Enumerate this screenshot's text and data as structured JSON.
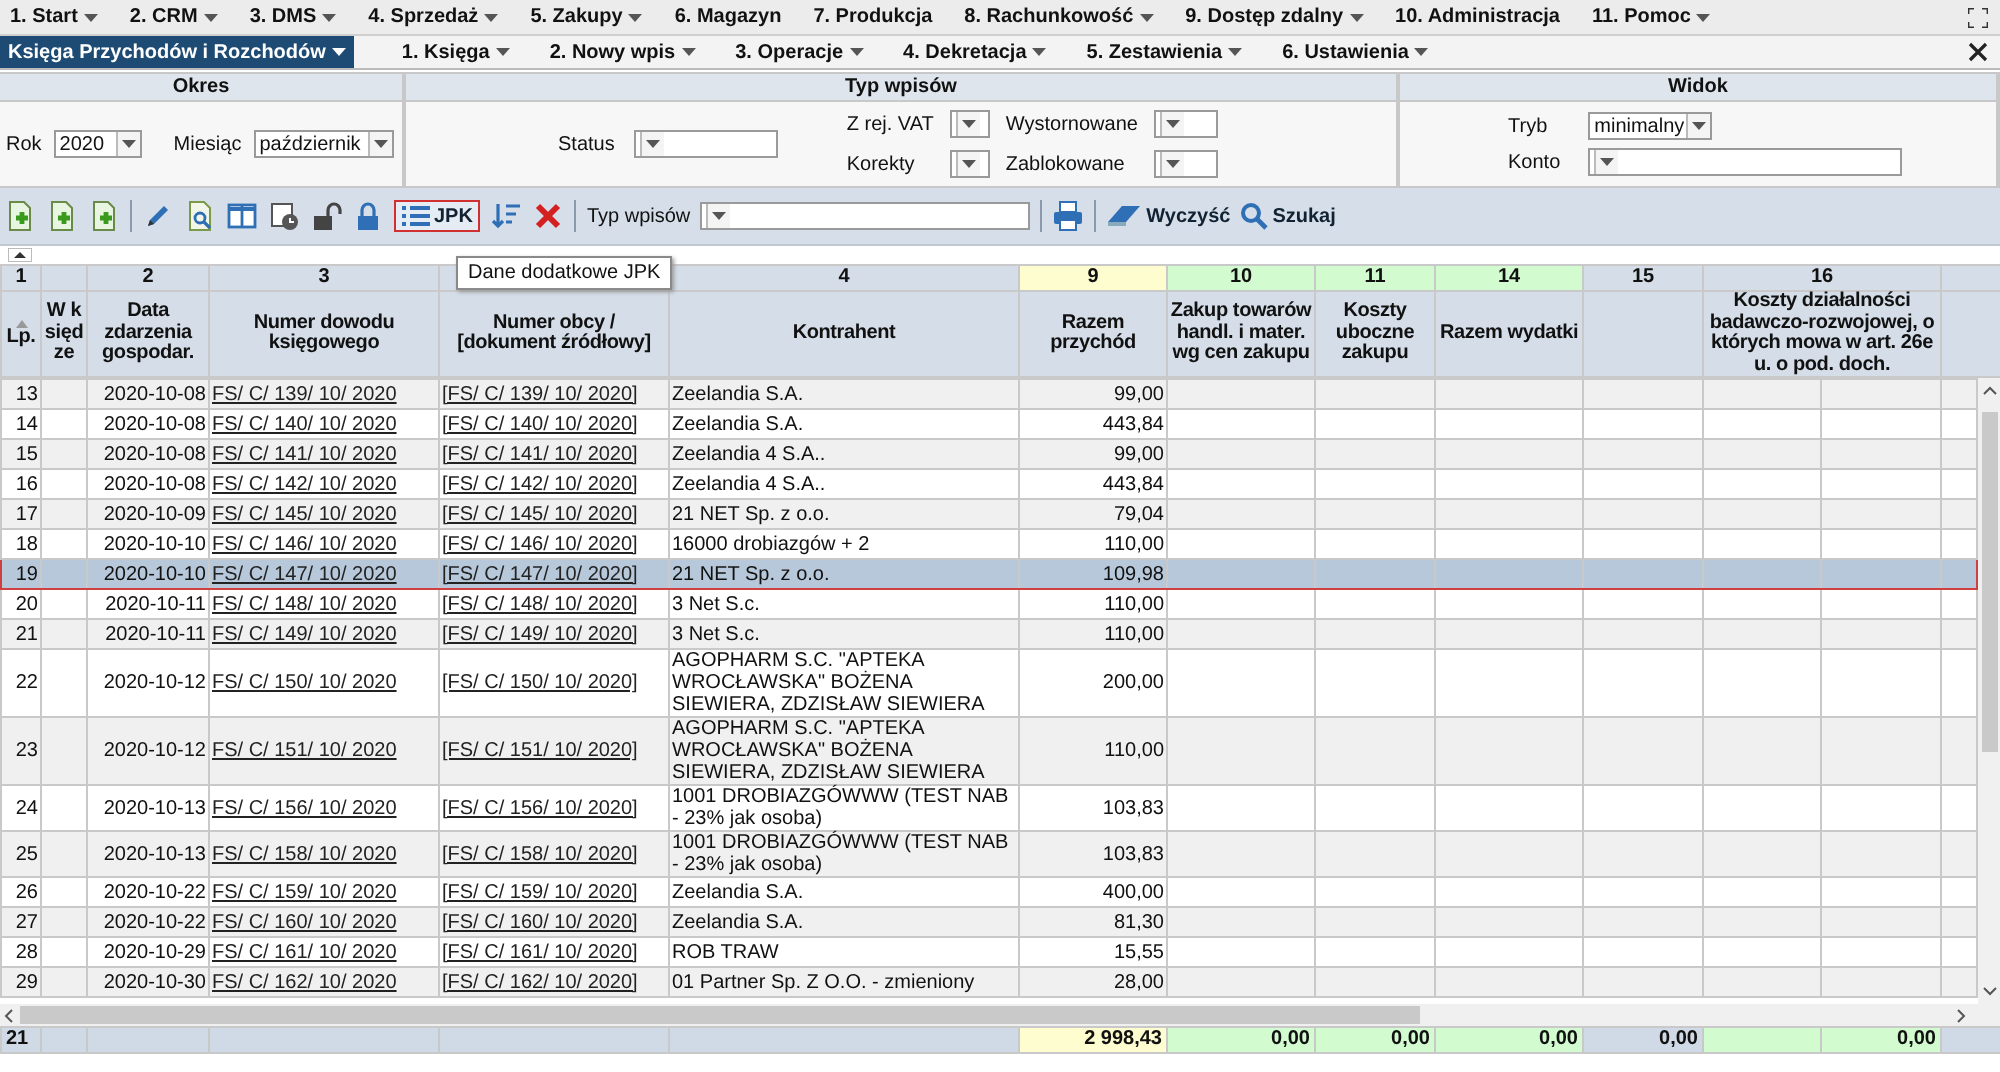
{
  "menu": [
    {
      "label": "1. Start",
      "dropdown": true
    },
    {
      "label": "2. CRM",
      "dropdown": true
    },
    {
      "label": "3. DMS",
      "dropdown": true
    },
    {
      "label": "4. Sprzedaż",
      "dropdown": true
    },
    {
      "label": "5. Zakupy",
      "dropdown": true
    },
    {
      "label": "6. Magazyn",
      "dropdown": false
    },
    {
      "label": "7. Produkcja",
      "dropdown": false
    },
    {
      "label": "8. Rachunkowość",
      "dropdown": true
    },
    {
      "label": "9. Dostęp zdalny",
      "dropdown": true
    },
    {
      "label": "10. Administracja",
      "dropdown": false
    },
    {
      "label": "11. Pomoc",
      "dropdown": true
    }
  ],
  "module_bar": {
    "tabs": [
      {
        "label": "Księga Przychodów i Rozchodów",
        "selected": true
      }
    ],
    "items": [
      {
        "label": "1. Księga"
      },
      {
        "label": "2. Nowy wpis"
      },
      {
        "label": "3. Operacje"
      },
      {
        "label": "4. Dekretacja"
      },
      {
        "label": "5. Zestawienia"
      },
      {
        "label": "6. Ustawienia"
      }
    ]
  },
  "filters": [
    {
      "title": "Okres",
      "fields": [
        {
          "label": "Rok",
          "value": "2020"
        },
        {
          "label": "Miesiąc",
          "value": "październik"
        }
      ]
    },
    {
      "title": "Typ wpisów",
      "fields": [
        {
          "label": "Status"
        },
        {
          "label": "Z rej. VAT"
        },
        {
          "label": "Korekty"
        },
        {
          "label": "Wystornowane"
        },
        {
          "label": "Zablokowane"
        }
      ]
    },
    {
      "title": "Widok",
      "fields": [
        {
          "label": "Tryb",
          "value": "minimalny"
        },
        {
          "label": "Konto"
        }
      ]
    }
  ],
  "toolbar": {
    "jpk_button": {
      "label": "JPK",
      "highlighted": true
    },
    "type_filter": {
      "label": "Typ wpisów"
    },
    "clear_button": "Wyczyść",
    "search_button": "Szukaj",
    "tooltip": "Dane dodatkowe JPK"
  },
  "table": {
    "columns": [
      {
        "number": "1",
        "header": "Lp.",
        "sorted": true
      },
      {
        "header": "W księdze",
        "sorted": false
      },
      {
        "number": "2",
        "header": "Data zdarzenia gospodar.",
        "sorted": false
      },
      {
        "number": "3",
        "header": "Numer dowodu księgowego",
        "sorted": false
      },
      {
        "header": "Numer obcy / [dokument źródłowy]",
        "sorted": false
      },
      {
        "number": "4",
        "header": "Kontrahent",
        "sorted": false
      },
      {
        "number": "9",
        "header": "Razem przychód",
        "sorted": false,
        "color": "#fdfdd0"
      },
      {
        "number": "10",
        "header": "Zakup towarów handl. i mater. wg cen zakupu",
        "sorted": false,
        "color": "#d3fbd0"
      },
      {
        "number": "11",
        "header": "Koszty uboczne zakupu",
        "sorted": false,
        "color": "#d3fbd0"
      },
      {
        "number": "14",
        "header": "Razem wydatki",
        "sorted": false,
        "color": "#d3fbd0"
      },
      {
        "number": "15",
        "sorted": false
      },
      {
        "number": "16",
        "header": "Koszty działalności badawczo-rozwojowej, o których mowa w art. 26e u. o pod. doch.",
        "sorted": false
      }
    ],
    "rows": [
      {
        "lp": "13",
        "date": "2020-10-08",
        "doc": "FS/ C/ 139/ 10/ 2020",
        "ext": "[FS/ C/ 139/ 10/ 2020]",
        "contractor": "Zeelandia S.A.",
        "income": "99,00",
        "selected": false
      },
      {
        "lp": "14",
        "date": "2020-10-08",
        "doc": "FS/ C/ 140/ 10/ 2020",
        "ext": "[FS/ C/ 140/ 10/ 2020]",
        "contractor": "Zeelandia S.A.",
        "income": "443,84",
        "selected": false
      },
      {
        "lp": "15",
        "date": "2020-10-08",
        "doc": "FS/ C/ 141/ 10/ 2020",
        "ext": "[FS/ C/ 141/ 10/ 2020]",
        "contractor": "Zeelandia 4 S.A..",
        "income": "99,00",
        "selected": false
      },
      {
        "lp": "16",
        "date": "2020-10-08",
        "doc": "FS/ C/ 142/ 10/ 2020",
        "ext": "[FS/ C/ 142/ 10/ 2020]",
        "contractor": "Zeelandia 4 S.A..",
        "income": "443,84",
        "selected": false
      },
      {
        "lp": "17",
        "date": "2020-10-09",
        "doc": "FS/ C/ 145/ 10/ 2020",
        "ext": "[FS/ C/ 145/ 10/ 2020]",
        "contractor": "21 NET Sp. z o.o.",
        "income": "79,04",
        "selected": false
      },
      {
        "lp": "18",
        "date": "2020-10-10",
        "doc": "FS/ C/ 146/ 10/ 2020",
        "ext": "[FS/ C/ 146/ 10/ 2020]",
        "contractor": "16000 drobiazgów + 2",
        "income": "110,00",
        "selected": false
      },
      {
        "lp": "19",
        "date": "2020-10-10",
        "doc": "FS/ C/ 147/ 10/ 2020",
        "ext": "[FS/ C/ 147/ 10/ 2020]",
        "contractor": "21 NET Sp. z o.o.",
        "income": "109,98",
        "selected": true
      },
      {
        "lp": "20",
        "date": "2020-10-11",
        "doc": "FS/ C/ 148/ 10/ 2020",
        "ext": "[FS/ C/ 148/ 10/ 2020]",
        "contractor": "3 Net S.c.",
        "income": "110,00",
        "selected": false
      },
      {
        "lp": "21",
        "date": "2020-10-11",
        "doc": "FS/ C/ 149/ 10/ 2020",
        "ext": "[FS/ C/ 149/ 10/ 2020]",
        "contractor": "3 Net S.c.",
        "income": "110,00",
        "selected": false
      },
      {
        "lp": "22",
        "date": "2020-10-12",
        "doc": "FS/ C/ 150/ 10/ 2020",
        "ext": "[FS/ C/ 150/ 10/ 2020]",
        "contractor": "AGOPHARM S.C. \"APTEKA WROCŁAWSKA\" BOŻENA SIEWIERA, ZDZISŁAW SIEWIERA",
        "income": "200,00",
        "selected": false
      },
      {
        "lp": "23",
        "date": "2020-10-12",
        "doc": "FS/ C/ 151/ 10/ 2020",
        "ext": "[FS/ C/ 151/ 10/ 2020]",
        "contractor": "AGOPHARM S.C. \"APTEKA WROCŁAWSKA\" BOŻENA SIEWIERA, ZDZISŁAW SIEWIERA",
        "income": "110,00",
        "selected": false
      },
      {
        "lp": "24",
        "date": "2020-10-13",
        "doc": "FS/ C/ 156/ 10/ 2020",
        "ext": "[FS/ C/ 156/ 10/ 2020]",
        "contractor": "1001 DROBIAZGÓWWW (TEST NAB - 23% jak osoba)",
        "income": "103,83",
        "selected": false
      },
      {
        "lp": "25",
        "date": "2020-10-13",
        "doc": "FS/ C/ 158/ 10/ 2020",
        "ext": "[FS/ C/ 158/ 10/ 2020]",
        "contractor": "1001 DROBIAZGÓWWW (TEST NAB - 23% jak osoba)",
        "income": "103,83",
        "selected": false
      },
      {
        "lp": "26",
        "date": "2020-10-22",
        "doc": "FS/ C/ 159/ 10/ 2020",
        "ext": "[FS/ C/ 159/ 10/ 2020]",
        "contractor": "Zeelandia S.A.",
        "income": "400,00",
        "selected": false
      },
      {
        "lp": "27",
        "date": "2020-10-22",
        "doc": "FS/ C/ 160/ 10/ 2020",
        "ext": "[FS/ C/ 160/ 10/ 2020]",
        "contractor": "Zeelandia S.A.",
        "income": "81,30",
        "selected": false
      },
      {
        "lp": "28",
        "date": "2020-10-29",
        "doc": "FS/ C/ 161/ 10/ 2020",
        "ext": "[FS/ C/ 161/ 10/ 2020]",
        "contractor": "ROB TRAW",
        "income": "15,55",
        "selected": false
      },
      {
        "lp": "29",
        "date": "2020-10-30",
        "doc": "FS/ C/ 162/ 10/ 2020",
        "ext": "[FS/ C/ 162/ 10/ 2020]",
        "contractor": "01 Partner Sp. Z O.O. - zmieniony",
        "income": "28,00",
        "selected": false
      }
    ],
    "footer": {
      "count": "21",
      "cells": [
        {
          "value": "2 998,43",
          "color": "#fdfdd0"
        },
        {
          "value": "0,00",
          "color": "#d3fbd0"
        },
        {
          "value": "0,00",
          "color": "#d3fbd0"
        },
        {
          "value": "0,00",
          "color": "#d3fbd0"
        },
        {
          "value": "0,00",
          "color": "#d0dae6"
        },
        {
          "color": "#d3fbd0"
        },
        {
          "value": "0,00",
          "color": "#d3fbd0"
        }
      ]
    }
  }
}
